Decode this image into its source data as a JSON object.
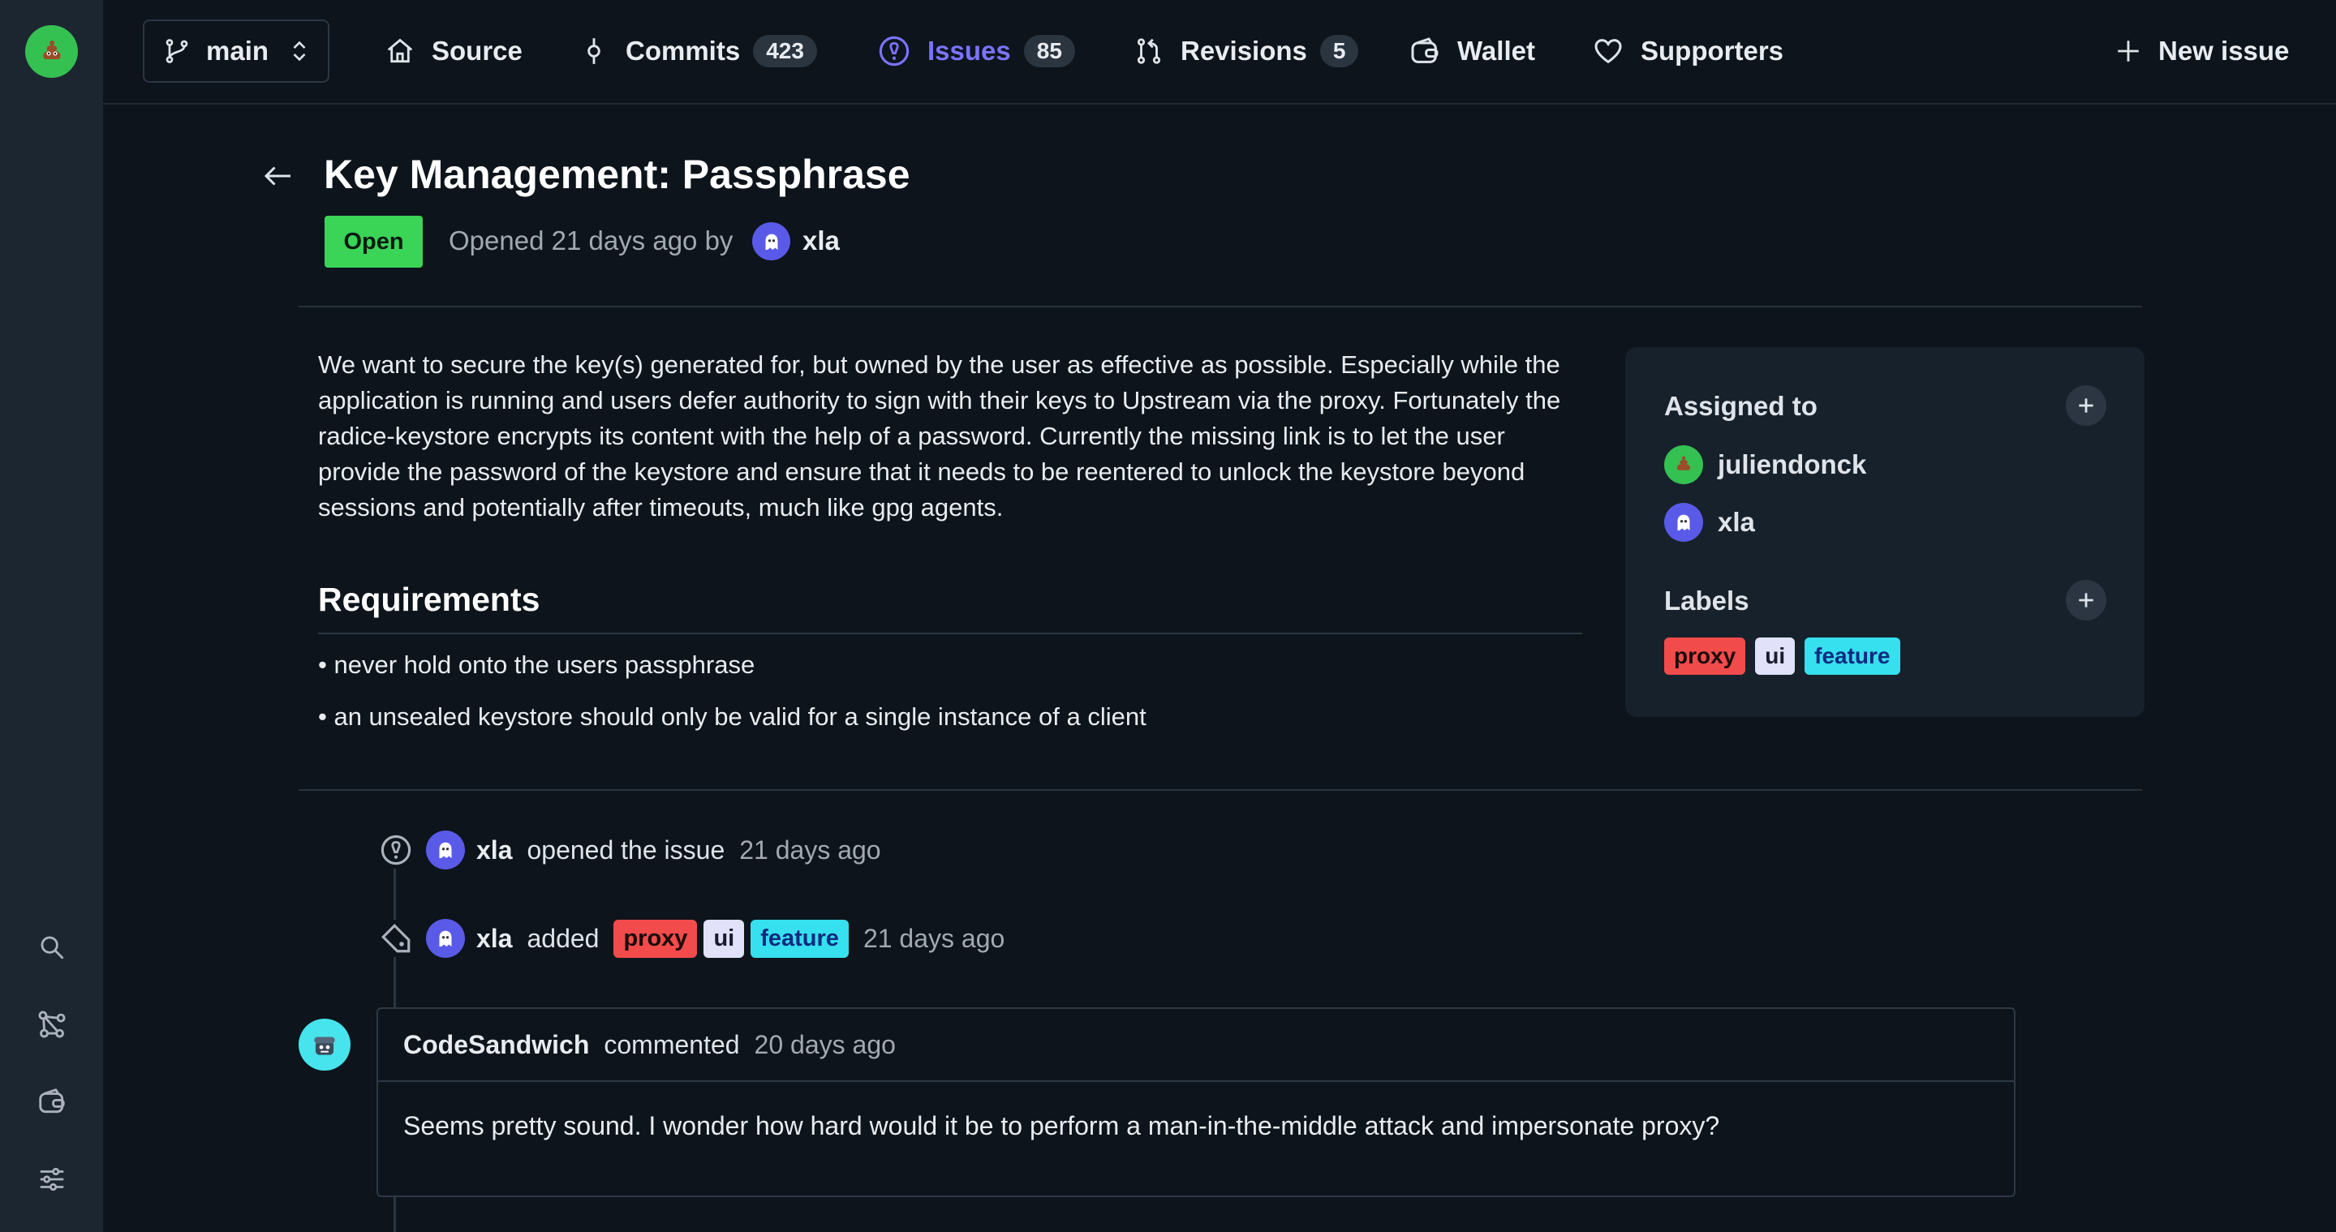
{
  "colors": {
    "accent": "#7b73ff",
    "open": "#3ad457",
    "bg": "#0d141b",
    "rail": "#1c2630"
  },
  "rail": {
    "logo_icon": "poop-avatar-icon",
    "buttons": [
      "search-icon",
      "network-icon",
      "wallet-icon",
      "settings-sliders-icon"
    ]
  },
  "topbar": {
    "branch": "main",
    "nav": [
      {
        "label": "Source",
        "icon": "home-icon"
      },
      {
        "label": "Commits",
        "count": "423",
        "icon": "commit-icon"
      },
      {
        "label": "Issues",
        "count": "85",
        "icon": "issue-icon",
        "active": true
      },
      {
        "label": "Revisions",
        "count": "5",
        "icon": "revision-icon"
      },
      {
        "label": "Wallet",
        "icon": "wallet-icon"
      },
      {
        "label": "Supporters",
        "icon": "heart-icon"
      }
    ],
    "new_issue": "New issue"
  },
  "issue": {
    "title": "Key Management: Passphrase",
    "status": "Open",
    "opened_text": "Opened 21 days ago by",
    "author": "xla",
    "description": "We want to secure the key(s) generated for, but owned by the user as effective as possible. Especially while the application is running and users defer authority to sign with their keys to Upstream via the proxy. Fortunately the radice-keystore encrypts its content with the help of a password. Currently the missing link is to let the user provide the password of the keystore and ensure that it needs to be reentered to unlock the keystore beyond sessions and potentially after timeouts, much like gpg agents.",
    "requirements_heading": "Requirements",
    "requirements": [
      "• never hold onto the users passphrase",
      "• an unsealed keystore should only be valid for a single instance of a client"
    ]
  },
  "sidebar": {
    "assigned_heading": "Assigned to",
    "assignees": [
      "juliendonck",
      "xla"
    ],
    "labels_heading": "Labels",
    "labels": [
      "proxy",
      "ui",
      "feature"
    ]
  },
  "timeline": [
    {
      "user": "xla",
      "action": "opened the issue",
      "time": "21 days ago"
    },
    {
      "user": "xla",
      "action": "added",
      "labels": [
        "proxy",
        "ui",
        "feature"
      ],
      "time": "21 days ago"
    }
  ],
  "comment": {
    "author": "CodeSandwich",
    "verb": "commented",
    "time": "20 days ago",
    "body": "Seems pretty sound. I wonder how hard would it be to perform a man-in-the-middle attack and impersonate proxy?"
  }
}
